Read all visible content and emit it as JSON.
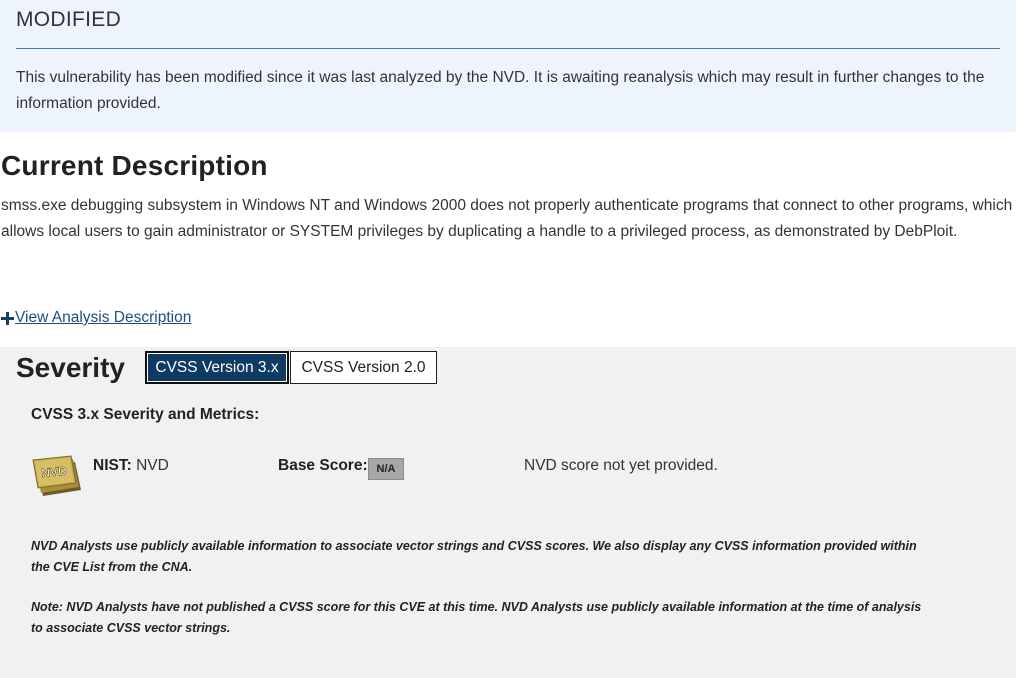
{
  "modified": {
    "title": "MODIFIED",
    "text": "This vulnerability has been modified since it was last analyzed by the NVD. It is awaiting reanalysis which may result in further changes to the information provided."
  },
  "description": {
    "title": "Current Description",
    "text": "smss.exe debugging subsystem in Windows NT and Windows 2000 does not properly authenticate programs that connect to other programs, which allows local users to gain administrator or SYSTEM privileges by duplicating a handle to a privileged process, as demonstrated by DebPloit.",
    "view_analysis_label": "View Analysis Description"
  },
  "severity": {
    "title": "Severity",
    "tabs": [
      {
        "label": "CVSS Version 3.x",
        "active": true
      },
      {
        "label": "CVSS Version 2.0",
        "active": false
      }
    ],
    "metrics_title": "CVSS 3.x Severity and Metrics:",
    "badge_text": "NVD",
    "nist_label": "NIST:",
    "nist_value": "NVD",
    "base_score_label": "Base Score:",
    "base_score_value": "N/A",
    "score_note": "NVD score not yet provided.",
    "note_1": "NVD Analysts use publicly available information to associate vector strings and CVSS scores. We also display any CVSS information provided within the CVE List from the CNA.",
    "note_2": "Note: NVD Analysts have not published a CVSS score for this CVE at this time. NVD Analysts use publicly available information at the time of analysis to associate CVSS vector strings."
  },
  "colors": {
    "banner_bg": "#eef4fc",
    "active_tab": "#0e3a63",
    "link": "#1f4e79",
    "panel_bg": "#f1f1f1"
  }
}
